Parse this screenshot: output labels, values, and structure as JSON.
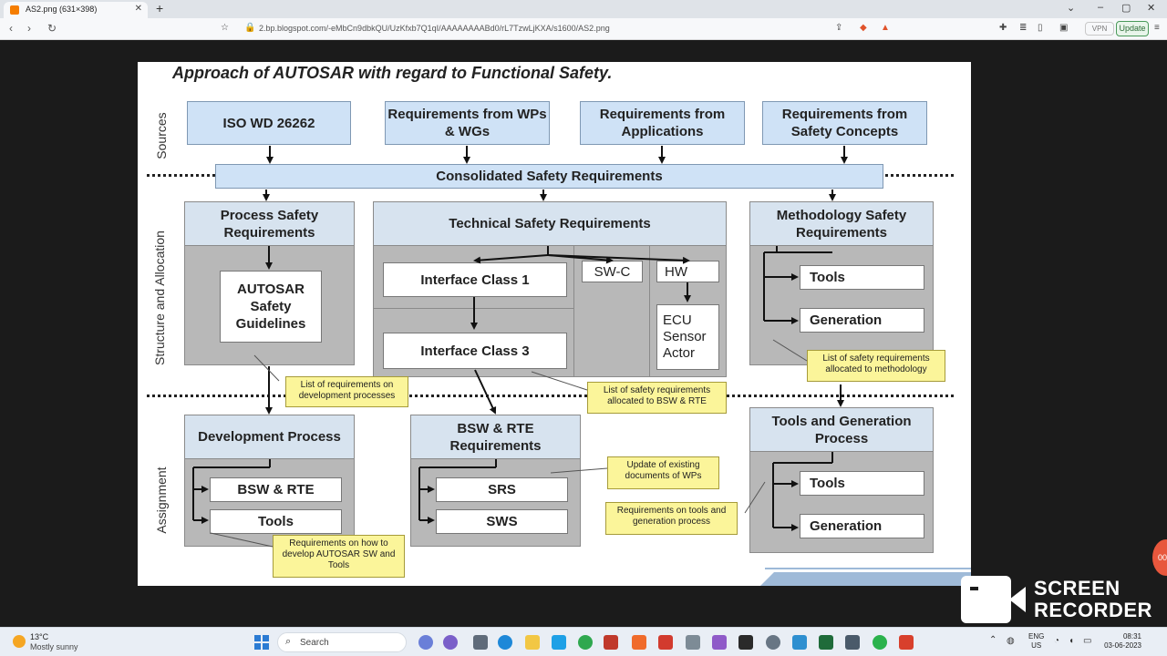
{
  "browser": {
    "tab_title": "AS2.png (631×398)",
    "tab_close": "✕",
    "new_tab": "+",
    "url": "2.bp.blogspot.com/-eMbCn9dbkQU/UzKfxb7Q1qI/AAAAAAAABd0/rL7TzwLjKXA/s1600/AS2.png",
    "vpn": "VPN",
    "update": "Update",
    "back_icon": "‹",
    "forward_icon": "›",
    "reload_icon": "↻",
    "min_icon": "–",
    "max_icon": "▢",
    "close_icon": "✕",
    "menu_icon": "≡"
  },
  "slide": {
    "title": "Approach of AUTOSAR with regard to Functional Safety.",
    "bands": {
      "sources": "Sources",
      "structure": "Structure and Allocation",
      "assignment": "Assignment"
    },
    "sources": [
      "ISO WD 26262",
      "Requirements from WPs & WGs",
      "Requirements from Applications",
      "Requirements from Safety Concepts"
    ],
    "consolidated": "Consolidated Safety Requirements",
    "process": {
      "header": "Process Safety Requirements",
      "item": "AUTOSAR Safety Guidelines"
    },
    "technical": {
      "header": "Technical Safety Requirements",
      "if1": "Interface Class 1",
      "if3": "Interface Class 3",
      "swc": "SW-C",
      "hw": "HW",
      "ecu": "ECU Sensor Actor"
    },
    "methodology": {
      "header": "Methodology Safety Requirements",
      "tools": "Tools",
      "generation": "Generation"
    },
    "dev_process": {
      "header": "Development Process",
      "bsw": "BSW & RTE",
      "tools": "Tools"
    },
    "bsw_rte": {
      "header": "BSW & RTE Requirements",
      "srs": "SRS",
      "sws": "SWS"
    },
    "tools_gen": {
      "header": "Tools and Generation Process",
      "tools": "Tools",
      "generation": "Generation"
    },
    "notes": {
      "dev_processes": "List of requirements on development processes",
      "bsw_rte": "List of safety requirements allocated to BSW & RTE",
      "methodology": "List of safety requirements allocated to methodology",
      "update_docs": "Update of existing documents of WPs",
      "tools_gen": "Requirements on tools and generation process",
      "develop_sw": "Requirements on how to develop AUTOSAR SW and Tools"
    }
  },
  "recorder": {
    "line1": "SCREEN",
    "line2": "RECORDER",
    "badge": "00"
  },
  "taskbar": {
    "weather_temp": "13°C",
    "weather_desc": "Mostly sunny",
    "search": "Search",
    "lang1": "ENG",
    "lang2": "US",
    "time": "08:31",
    "date": "03-06-2023"
  }
}
